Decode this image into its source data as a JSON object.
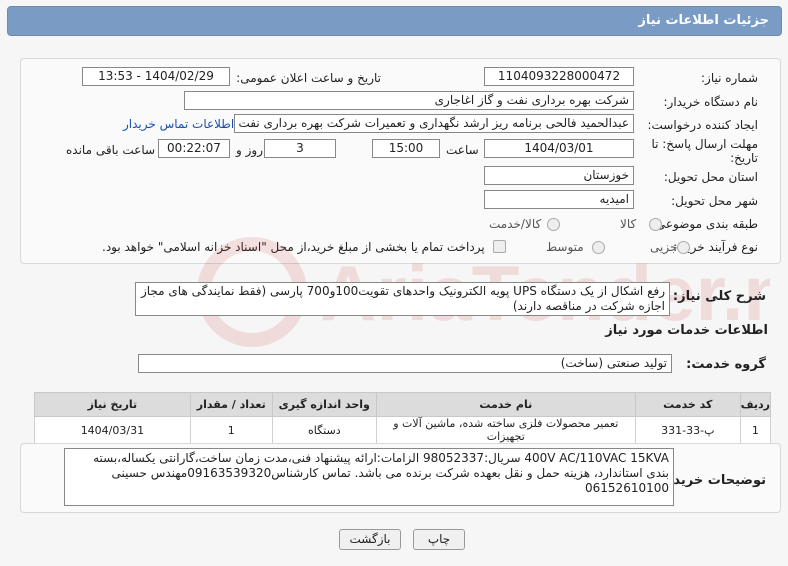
{
  "header": {
    "title": "جزئیات اطلاعات نیاز"
  },
  "form": {
    "need_number_label": "شماره نیاز:",
    "need_number": "1104093228000472",
    "announce_label": "تاریخ و ساعت اعلان عمومی:",
    "announce_value": "1404/02/29 - 13:53",
    "buyer_org_label": "نام دستگاه خریدار:",
    "buyer_org": "شرکت بهره برداری نفت و گاز اغاجاری",
    "creator_label": "ایجاد کننده درخواست:",
    "creator": "عبدالحمید فالحی برنامه ریز ارشد نگهداری و تعمیرات شرکت بهره برداری نفت و",
    "contact_link": "اطلاعات تماس خریدار",
    "deadline_label": "مهلت ارسال پاسخ: تا تاریخ:",
    "deadline_date": "1404/03/01",
    "time_label": "ساعت",
    "deadline_time": "15:00",
    "days_value": "3",
    "days_label": "روز و",
    "remaining_time": "00:22:07",
    "remaining_label": "ساعت باقی مانده",
    "province_label": "استان محل تحویل:",
    "province": "خوزستان",
    "city_label": "شهر محل تحویل:",
    "city": "امیدیه",
    "category_label": "طبقه بندی موضوعی:",
    "category_options": [
      "کالا",
      "کالا/خدمت"
    ],
    "process_label": "نوع فرآیند خرید :",
    "process_options": [
      "جزیی",
      "متوسط"
    ],
    "payment_note": "پرداخت تمام یا بخشی از مبلغ خرید،از محل \"اسناد خزانه اسلامی\" خواهد بود."
  },
  "description": {
    "label": "شرح کلی نیاز:",
    "text": "رفع اشکال از یک دستگاه UPS پویه الکترونیک واحدهای تقویت100و700 پارسی (فقط نمایندگی های مجاز اجازه شرکت در مناقصه دارند)"
  },
  "services": {
    "section_title": "اطلاعات خدمات مورد نیاز",
    "group_label": "گروه خدمت:",
    "group_value": "تولید صنعتی (ساخت)",
    "columns": [
      "ردیف",
      "کد خدمت",
      "نام خدمت",
      "واحد اندازه گیری",
      "تعداد / مقدار",
      "تاریخ نیاز"
    ],
    "rows": [
      [
        "1",
        "پ-33-331",
        "تعمیر محصولات فلزی ساخته شده، ماشین آلات و تجهیزات",
        "دستگاه",
        "1",
        "1404/03/31"
      ]
    ]
  },
  "buyer_notes": {
    "label": "توضیحات خریدار:",
    "text": "400V AC/110VAC 15KVA سریال:98052337 الزامات:ارائه پیشنهاد فنی،مدت زمان ساخت،گارانتی یکساله،بسته بندی استاندارد، هزینه حمل و نقل بعهده شرکت برنده می باشد. تماس کارشناس09163539320مهندس حسینی 06152610100"
  },
  "buttons": {
    "print": "چاپ",
    "back": "بازگشت"
  },
  "watermark": {
    "text": "AriaTender.net"
  },
  "colors": {
    "header_bg": "#7a9cc4",
    "link": "#1a4fb0",
    "watermark": "#cc2222"
  }
}
